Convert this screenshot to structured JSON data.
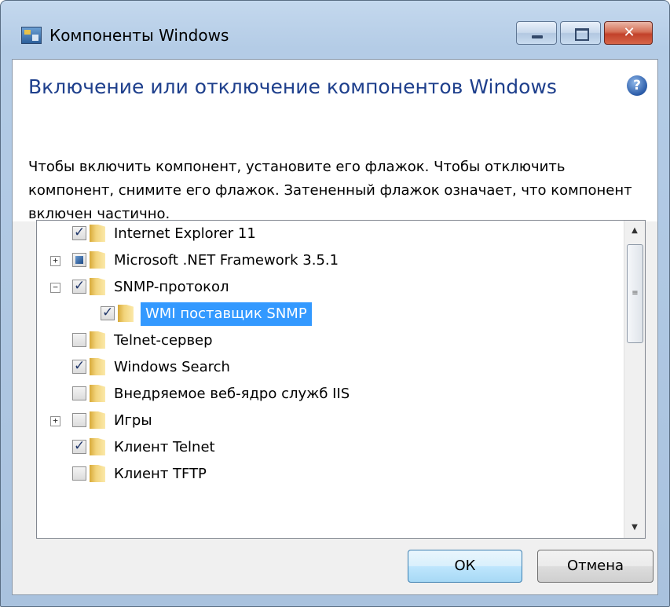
{
  "window": {
    "title": "Компоненты Windows",
    "caption_buttons": {
      "minimize": "minimize",
      "maximize": "maximize",
      "close": "✕"
    }
  },
  "header": {
    "title": "Включение или отключение компонентов Windows",
    "help": "?"
  },
  "description": "Чтобы включить компонент, установите его флажок. Чтобы отключить компонент, снимите его флажок. Затененный флажок означает, что компонент включен частично.",
  "features": [
    {
      "label": "Internet Explorer 11",
      "state": "checked",
      "expander": "",
      "level": 0
    },
    {
      "label": "Microsoft .NET Framework 3.5.1",
      "state": "partial",
      "expander": "+",
      "level": 0
    },
    {
      "label": "SNMP-протокол",
      "state": "checked",
      "expander": "−",
      "level": 0
    },
    {
      "label": "WMI поставщик SNMP",
      "state": "checked",
      "expander": "",
      "level": 1,
      "selected": true
    },
    {
      "label": "Telnet-сервер",
      "state": "unchecked",
      "expander": "",
      "level": 0
    },
    {
      "label": "Windows Search",
      "state": "checked",
      "expander": "",
      "level": 0
    },
    {
      "label": "Внедряемое веб-ядро служб IIS",
      "state": "unchecked",
      "expander": "",
      "level": 0
    },
    {
      "label": "Игры",
      "state": "unchecked",
      "expander": "+",
      "level": 0
    },
    {
      "label": "Клиент Telnet",
      "state": "checked",
      "expander": "",
      "level": 0
    },
    {
      "label": "Клиент TFTP",
      "state": "unchecked",
      "expander": "",
      "level": 0
    }
  ],
  "scrollbar": {
    "up": "▲",
    "down": "▼",
    "grip": "≡"
  },
  "buttons": {
    "ok": "ОК",
    "cancel": "Отмена"
  }
}
